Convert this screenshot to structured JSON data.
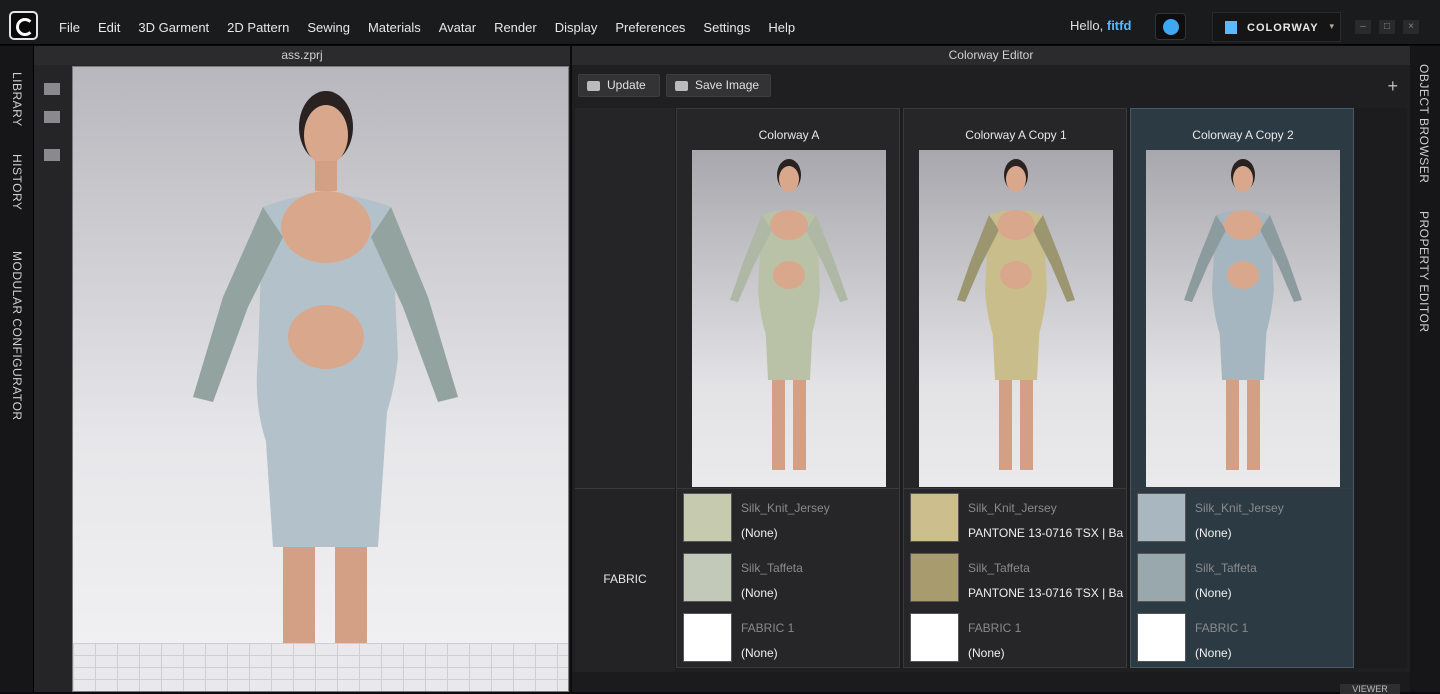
{
  "menu": [
    "File",
    "Edit",
    "3D Garment",
    "2D Pattern",
    "Sewing",
    "Materials",
    "Avatar",
    "Render",
    "Display",
    "Preferences",
    "Settings",
    "Help"
  ],
  "header": {
    "hello_prefix": "Hello, ",
    "username": "fitfd",
    "colorway_button": "COLORWAY"
  },
  "left_tabs": [
    "LIBRARY",
    "HISTORY",
    "MODULAR CONFIGURATOR"
  ],
  "right_tabs": [
    "OBJECT BROWSER",
    "PROPERTY EDITOR"
  ],
  "viewport": {
    "title": "ass.zprj"
  },
  "colorway_editor": {
    "title": "Colorway Editor",
    "update_label": "Update",
    "save_image_label": "Save Image",
    "fabric_label": "FABRIC",
    "colorways": [
      {
        "name": "Colorway A",
        "dress_color": "#b9c2a7",
        "sleeve_color": "#aeb8a5",
        "rows": [
          {
            "fabric": "Silk_Knit_Jersey",
            "value": "(None)",
            "swatch": "#c6cbb0"
          },
          {
            "fabric": "Silk_Taffeta",
            "value": "(None)",
            "swatch": "#c2c9b8"
          },
          {
            "fabric": "FABRIC 1",
            "value": "(None)",
            "swatch": "#ffffff"
          }
        ]
      },
      {
        "name": "Colorway A Copy 1",
        "dress_color": "#c9bd8c",
        "sleeve_color": "#9c9670",
        "rows": [
          {
            "fabric": "Silk_Knit_Jersey",
            "value": "PANTONE 13-0716 TSX | Ba",
            "swatch": "#cdbf8d"
          },
          {
            "fabric": "Silk_Taffeta",
            "value": "PANTONE 13-0716 TSX | Ba",
            "swatch": "#a89b6e"
          },
          {
            "fabric": "FABRIC 1",
            "value": "(None)",
            "swatch": "#ffffff"
          }
        ]
      },
      {
        "name": "Colorway A Copy 2",
        "dress_color": "#a6b6c0",
        "sleeve_color": "#8c9c9e",
        "rows": [
          {
            "fabric": "Silk_Knit_Jersey",
            "value": "(None)",
            "swatch": "#a9b7c0"
          },
          {
            "fabric": "Silk_Taffeta",
            "value": "(None)",
            "swatch": "#98a8ad"
          },
          {
            "fabric": "FABRIC 1",
            "value": "(None)",
            "swatch": "#ffffff"
          }
        ]
      }
    ]
  },
  "bottom": {
    "viewer_label": "VIEWER"
  }
}
